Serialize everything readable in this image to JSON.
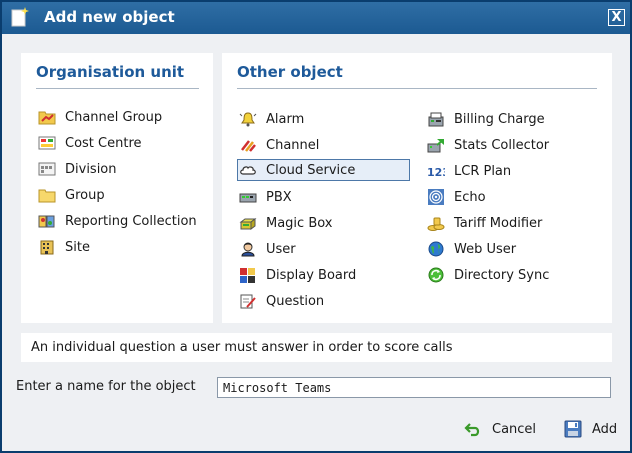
{
  "dialog": {
    "title": "Add new object",
    "close_label": "X"
  },
  "organisation_unit": {
    "heading": "Organisation unit",
    "items": [
      {
        "label": "Channel Group",
        "icon": "folder-chart-icon"
      },
      {
        "label": "Cost Centre",
        "icon": "cost-centre-icon"
      },
      {
        "label": "Division",
        "icon": "division-icon"
      },
      {
        "label": "Group",
        "icon": "folder-icon"
      },
      {
        "label": "Reporting Collection",
        "icon": "reporting-collection-icon"
      },
      {
        "label": "Site",
        "icon": "site-building-icon"
      }
    ]
  },
  "other_object": {
    "heading": "Other object",
    "selected": "Cloud Service",
    "left_items": [
      {
        "label": "Alarm",
        "icon": "alarm-bell-icon"
      },
      {
        "label": "Channel",
        "icon": "channel-icon"
      },
      {
        "label": "Cloud Service",
        "icon": "cloud-icon"
      },
      {
        "label": "PBX",
        "icon": "pbx-icon"
      },
      {
        "label": "Magic Box",
        "icon": "magic-box-icon"
      },
      {
        "label": "User",
        "icon": "user-icon"
      },
      {
        "label": "Display Board",
        "icon": "display-board-icon"
      },
      {
        "label": "Question",
        "icon": "question-icon"
      }
    ],
    "right_items": [
      {
        "label": "Billing Charge",
        "icon": "billing-charge-icon"
      },
      {
        "label": "Stats Collector",
        "icon": "stats-collector-icon"
      },
      {
        "label": "LCR Plan",
        "icon": "lcr-plan-icon"
      },
      {
        "label": "Echo",
        "icon": "echo-icon"
      },
      {
        "label": "Tariff Modifier",
        "icon": "tariff-modifier-icon"
      },
      {
        "label": "Web User",
        "icon": "web-user-icon"
      },
      {
        "label": "Directory Sync",
        "icon": "directory-sync-icon"
      }
    ]
  },
  "description": "An individual question a user must answer in order to score calls",
  "name_field": {
    "label": "Enter a name for the object",
    "value": "Microsoft Teams"
  },
  "buttons": {
    "cancel": "Cancel",
    "add": "Add"
  },
  "colors": {
    "title_bar": "#1c5a92",
    "heading": "#1e5a9a",
    "background": "#eef0f3"
  }
}
